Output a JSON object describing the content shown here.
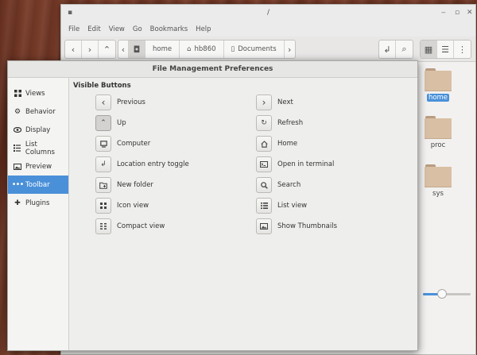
{
  "file_manager": {
    "title": "/",
    "menu": [
      "File",
      "Edit",
      "View",
      "Go",
      "Bookmarks",
      "Help"
    ],
    "breadcrumbs": [
      "home",
      "hb860",
      "Documents"
    ],
    "files": [
      {
        "name": "home",
        "selected": true
      },
      {
        "name": "proc",
        "selected": false
      },
      {
        "name": "sys",
        "selected": false
      }
    ],
    "zoom_fraction": 0.4
  },
  "prefs": {
    "title": "File Management Preferences",
    "sidebar": [
      {
        "label": "Views",
        "icon": "grid-icon",
        "active": false
      },
      {
        "label": "Behavior",
        "icon": "gear-icon",
        "active": false
      },
      {
        "label": "Display",
        "icon": "eye-icon",
        "active": false
      },
      {
        "label": "List Columns",
        "icon": "list-icon",
        "active": false
      },
      {
        "label": "Preview",
        "icon": "image-icon",
        "active": false
      },
      {
        "label": "Toolbar",
        "icon": "dots-icon",
        "active": true
      },
      {
        "label": "Plugins",
        "icon": "puzzle-icon",
        "active": false
      }
    ],
    "section_title": "Visible Buttons",
    "options_left": [
      {
        "label": "Previous",
        "icon": "chevron-left-icon",
        "on": false
      },
      {
        "label": "Up",
        "icon": "chevron-up-icon",
        "on": true
      },
      {
        "label": "Computer",
        "icon": "computer-icon",
        "on": false
      },
      {
        "label": "Location entry toggle",
        "icon": "location-entry-icon",
        "on": false
      },
      {
        "label": "New folder",
        "icon": "new-folder-icon",
        "on": false
      },
      {
        "label": "Icon view",
        "icon": "icon-view-icon",
        "on": false
      },
      {
        "label": "Compact view",
        "icon": "compact-view-icon",
        "on": false
      }
    ],
    "options_right": [
      {
        "label": "Next",
        "icon": "chevron-right-icon",
        "on": false
      },
      {
        "label": "Refresh",
        "icon": "refresh-icon",
        "on": false
      },
      {
        "label": "Home",
        "icon": "home-icon",
        "on": false
      },
      {
        "label": "Open in terminal",
        "icon": "terminal-icon",
        "on": false
      },
      {
        "label": "Search",
        "icon": "search-icon",
        "on": false
      },
      {
        "label": "List view",
        "icon": "list-view-icon",
        "on": false
      },
      {
        "label": "Show Thumbnails",
        "icon": "thumbnail-icon",
        "on": false
      }
    ]
  },
  "colors": {
    "accent": "#4a90d9",
    "wood": "#6b3322"
  }
}
